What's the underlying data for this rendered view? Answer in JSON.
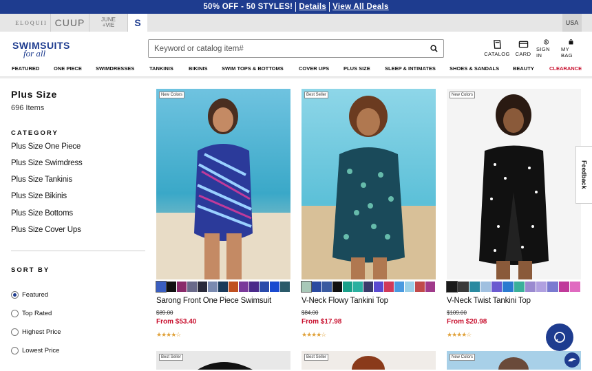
{
  "promo": {
    "text": "50% OFF - 50 STYLES!",
    "details": "Details",
    "view_all": "View All Deals"
  },
  "brands": {
    "eloquii": "ELOQUII",
    "cuup": "CUUP",
    "june_1": "JUNE",
    "june_2": "+VIE",
    "s": "S"
  },
  "country": "USA",
  "logo": {
    "line1": "SWIMSUITS",
    "line2": "for all"
  },
  "search": {
    "placeholder": "Keyword or catalog item#",
    "icon": "search-icon"
  },
  "utility": [
    {
      "label": "CATALOG",
      "icon": "catalog-icon"
    },
    {
      "label": "CARD",
      "icon": "card-icon"
    },
    {
      "label": "SIGN IN",
      "icon": "user-icon"
    },
    {
      "label": "MY BAG",
      "icon": "bag-icon"
    }
  ],
  "nav": [
    "FEATURED",
    "ONE PIECE",
    "SWIMDRESSES",
    "TANKINIS",
    "BIKINIS",
    "SWIM TOPS & BOTTOMS",
    "COVER UPS",
    "PLUS SIZE",
    "SLEEP & INTIMATES",
    "SHOES & SANDALS",
    "BEAUTY",
    "CLEARANCE"
  ],
  "page": {
    "title": "Plus Size",
    "count": "696 Items"
  },
  "category": {
    "heading": "CATEGORY",
    "links": [
      "Plus Size One Piece",
      "Plus Size Swimdress",
      "Plus Size Tankinis",
      "Plus Size Bikinis",
      "Plus Size Bottoms",
      "Plus Size Cover Ups"
    ]
  },
  "sort": {
    "heading": "SORT BY",
    "options": [
      "Featured",
      "Top Rated",
      "Highest Price",
      "Lowest Price"
    ],
    "selected": "Featured"
  },
  "products": [
    {
      "badge": "New Colors",
      "name": "Sarong Front One Piece Swimsuit",
      "was": "$89.00",
      "now": "From $53.40",
      "rating": 4.5,
      "swatches": [
        "#3a5ec0",
        "#111111",
        "#8a2a6a",
        "#6a6a8a",
        "#2a2a3a",
        "#7a8ab0",
        "#1a3a5a",
        "#c05020",
        "#7a3a9a",
        "#4a2a8a",
        "#2a4aaa",
        "#1a4ad0",
        "#2a5a6a"
      ]
    },
    {
      "badge": "Best Seller",
      "name": "V-Neck Flowy Tankini Top",
      "was": "$84.00",
      "now": "From $17.98",
      "rating": 4.5,
      "swatches": [
        "#a8c8b8",
        "#2a4aa0",
        "#3a5aa0",
        "#111111",
        "#1aa08a",
        "#2ab0a0",
        "#3a3a6a",
        "#5a4ad0",
        "#d03a5a",
        "#4a9ae0",
        "#9ad0e8",
        "#c04a4a",
        "#a03a8a"
      ]
    },
    {
      "badge": "New Colors",
      "name": "V-Neck Twist Tankini Top",
      "was": "$109.00",
      "now": "From $20.98",
      "rating": 4.5,
      "swatches": [
        "#1a1a1a",
        "#3a3a3a",
        "#2a8aa0",
        "#a0c0e0",
        "#6a5ad0",
        "#2a7ad0",
        "#3ab09a",
        "#9a8ad0",
        "#b0a0e0",
        "#7a7ad0",
        "#c03a9a",
        "#e06ac0"
      ]
    }
  ],
  "products_row2": [
    {
      "badge": "Best Seller"
    },
    {
      "badge": "Best Seller"
    },
    {
      "badge": "New Colors"
    }
  ],
  "feedback": "Feedback",
  "colors": {
    "brand_blue": "#1e3c8f",
    "sale_red": "#c8102e",
    "star": "#e0a23b"
  }
}
